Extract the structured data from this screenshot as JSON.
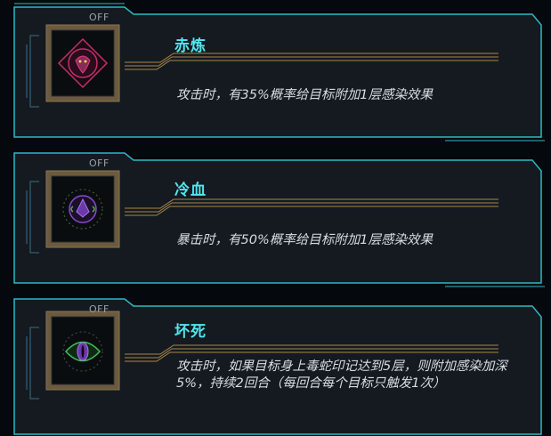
{
  "skills": [
    {
      "status": "OFF",
      "name": "赤炼",
      "description": "攻击时，有35%概率给目标附加1层感染效果",
      "icon": "red-snake-emblem-icon",
      "icon_color": "#c0306a"
    },
    {
      "status": "OFF",
      "name": "冷血",
      "description": "暴击时，有50%概率给目标附加1层感染效果",
      "icon": "purple-crystal-emblem-icon",
      "icon_color": "#8a4ad0"
    },
    {
      "status": "OFF",
      "name": "坏死",
      "description": "攻击时，如果目标身上毒蛇印记达到5层，则附加感染加深5%，持续2回合（每回合每个目标只触发1次）",
      "icon": "green-eye-emblem-icon",
      "icon_color": "#3fbf5a"
    }
  ],
  "colors": {
    "accent_cyan": "#52e6ee",
    "frame_cyan": "#2fb7c4",
    "gold_line": "#a9864a",
    "panel_bg": "#141a20"
  }
}
